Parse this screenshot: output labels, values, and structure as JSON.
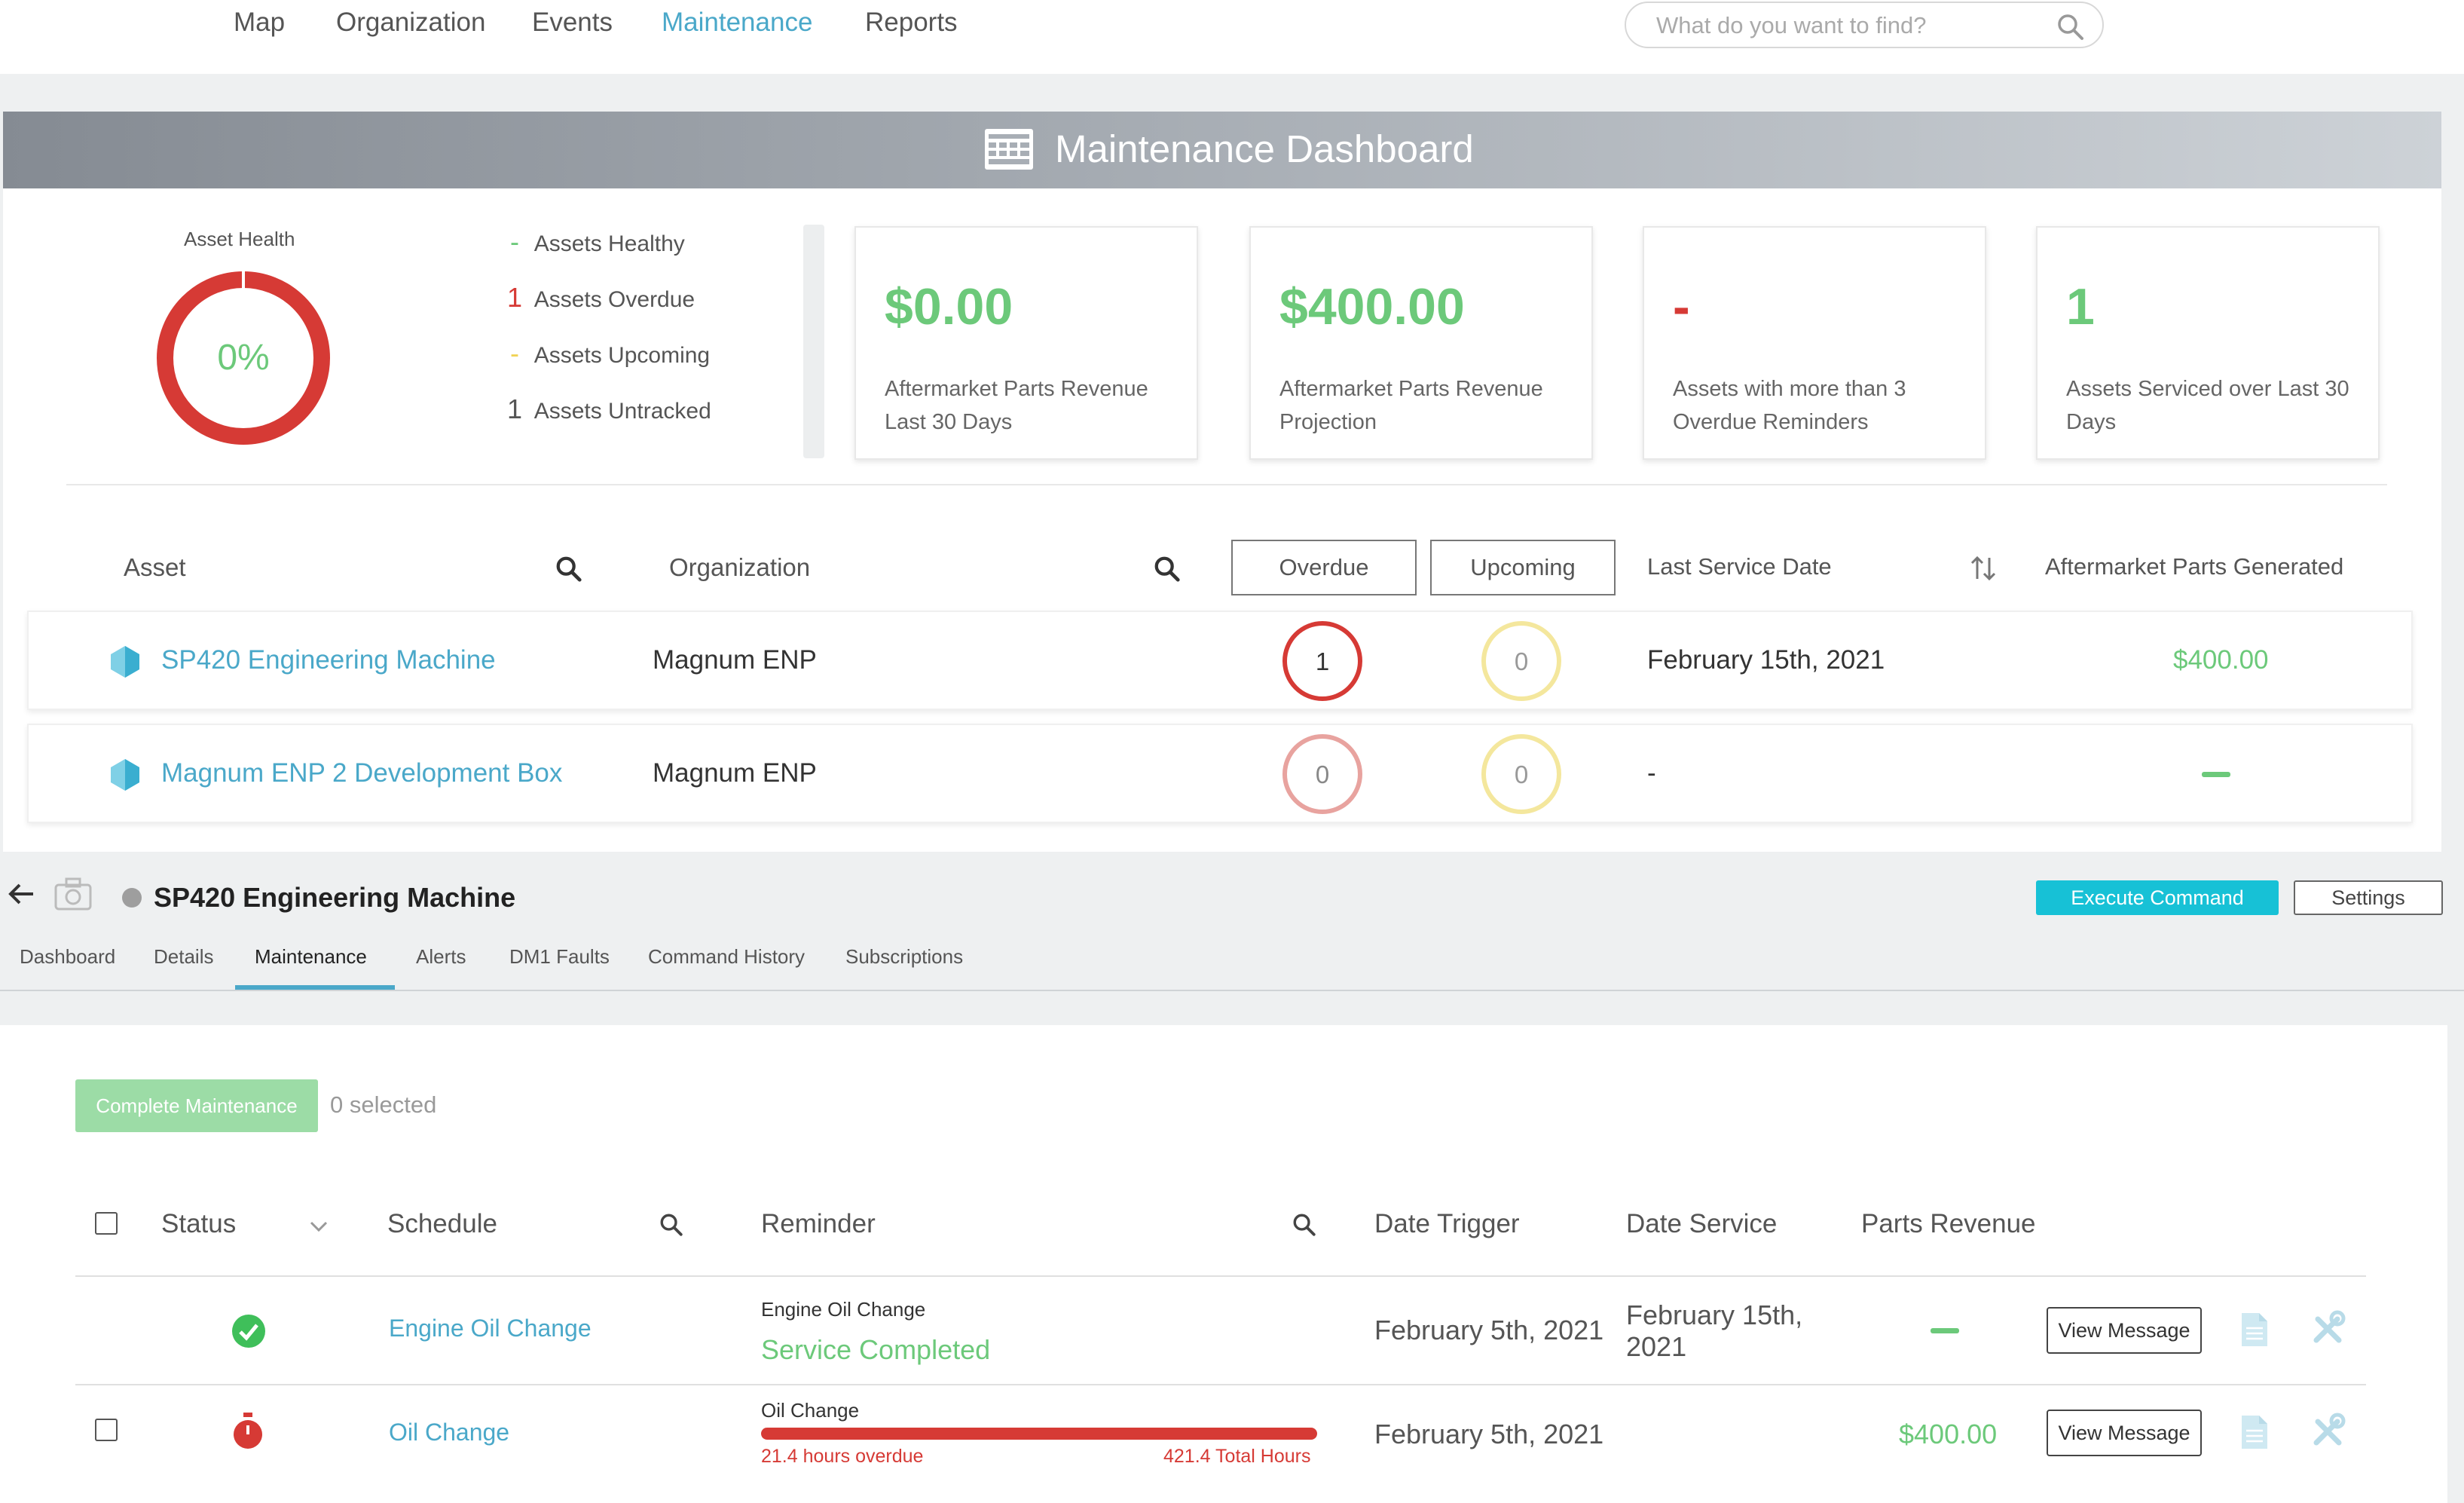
{
  "nav": {
    "items": [
      "Map",
      "Organization",
      "Events",
      "Maintenance",
      "Reports"
    ],
    "active": "Maintenance",
    "search_placeholder": "What do you want to find?"
  },
  "dashboard": {
    "title": "Maintenance Dashboard"
  },
  "asset_health": {
    "title": "Asset Health",
    "percent_label": "0%",
    "healthy_percent": 0,
    "legend": [
      {
        "num": "-",
        "label": "Assets Healthy"
      },
      {
        "num": "1",
        "label": "Assets Overdue"
      },
      {
        "num": "-",
        "label": "Assets Upcoming"
      },
      {
        "num": "1",
        "label": "Assets Untracked"
      }
    ]
  },
  "kpis": [
    {
      "value": "$0.00",
      "label": "Aftermarket Parts Revenue Last 30 Days"
    },
    {
      "value": "$400.00",
      "label": "Aftermarket Parts Revenue Projection"
    },
    {
      "value": "-",
      "label": "Assets with more than 3 Overdue Reminders"
    },
    {
      "value": "1",
      "label": "Assets Serviced over Last 30 Days"
    }
  ],
  "asset_table": {
    "headers": {
      "asset": "Asset",
      "organization": "Organization",
      "overdue": "Overdue",
      "upcoming": "Upcoming",
      "last_service": "Last Service Date",
      "parts": "Aftermarket Parts Generated"
    },
    "rows": [
      {
        "name": "SP420 Engineering Machine",
        "org": "Magnum ENP",
        "overdue": "1",
        "upcoming": "0",
        "last_service": "February 15th, 2021",
        "parts": "$400.00"
      },
      {
        "name": "Magnum ENP 2 Development Box",
        "org": "Magnum ENP",
        "overdue": "0",
        "upcoming": "0",
        "last_service": "-",
        "parts": ""
      }
    ]
  },
  "asset_detail": {
    "title": "SP420 Engineering Machine",
    "execute_label": "Execute Command",
    "settings_label": "Settings",
    "tabs": [
      "Dashboard",
      "Details",
      "Maintenance",
      "Alerts",
      "DM1 Faults",
      "Command History",
      "Subscriptions"
    ],
    "active_tab": "Maintenance"
  },
  "maintenance": {
    "complete_label": "Complete Maintenance",
    "selected_text": "0 selected",
    "headers": {
      "status": "Status",
      "schedule": "Schedule",
      "reminder": "Reminder",
      "date_trigger": "Date Trigger",
      "date_service": "Date Service",
      "parts_revenue": "Parts Revenue"
    },
    "rows": [
      {
        "status": "completed",
        "schedule": "Engine Oil Change",
        "reminder_title": "Engine Oil Change",
        "reminder_status": "Service Completed",
        "date_trigger": "February 5th, 2021",
        "date_service": "February 15th, 2021",
        "parts_revenue": "",
        "button": "View Message"
      },
      {
        "status": "overdue",
        "schedule": "Oil Change",
        "reminder_title": "Oil Change",
        "overdue_text": "21.4 hours overdue",
        "total_text": "421.4 Total Hours",
        "date_trigger": "February 5th, 2021",
        "date_service": "",
        "parts_revenue": "$400.00",
        "button": "View Message"
      }
    ]
  },
  "colors": {
    "accent": "#4aa8c9",
    "green": "#6cc97a",
    "red": "#d63a35",
    "cyan_button": "#17c1d6"
  }
}
